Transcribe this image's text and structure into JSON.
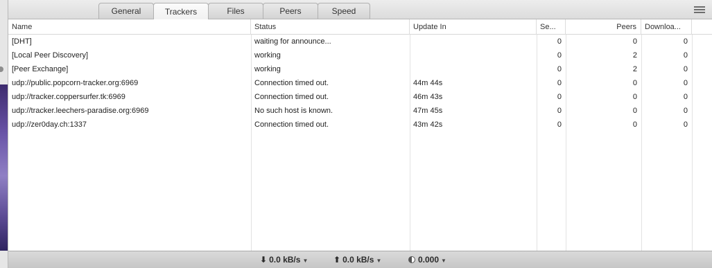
{
  "tabs": [
    {
      "label": "General"
    },
    {
      "label": "Trackers"
    },
    {
      "label": "Files"
    },
    {
      "label": "Peers"
    },
    {
      "label": "Speed"
    }
  ],
  "active_tab": "Trackers",
  "columns": {
    "name": "Name",
    "status": "Status",
    "update_in": "Update In",
    "seeds": "Se...",
    "peers": "Peers",
    "downloads": "Downloa..."
  },
  "rows": [
    {
      "name": "[DHT]",
      "status": "waiting for announce...",
      "update_in": "",
      "seeds": "0",
      "peers": "0",
      "downloads": "0"
    },
    {
      "name": "[Local Peer Discovery]",
      "status": "working",
      "update_in": "",
      "seeds": "0",
      "peers": "2",
      "downloads": "0"
    },
    {
      "name": "[Peer Exchange]",
      "status": "working",
      "update_in": "",
      "seeds": "0",
      "peers": "2",
      "downloads": "0"
    },
    {
      "name": "udp://public.popcorn-tracker.org:6969",
      "status": "Connection timed out.",
      "update_in": "44m 44s",
      "seeds": "0",
      "peers": "0",
      "downloads": "0"
    },
    {
      "name": "udp://tracker.coppersurfer.tk:6969",
      "status": "Connection timed out.",
      "update_in": "46m 43s",
      "seeds": "0",
      "peers": "0",
      "downloads": "0"
    },
    {
      "name": "udp://tracker.leechers-paradise.org:6969",
      "status": "No such host is known.",
      "update_in": "47m 45s",
      "seeds": "0",
      "peers": "0",
      "downloads": "0"
    },
    {
      "name": "udp://zer0day.ch:1337",
      "status": "Connection timed out.",
      "update_in": "43m 42s",
      "seeds": "0",
      "peers": "0",
      "downloads": "0"
    }
  ],
  "statusbar": {
    "download_rate": "0.0 kB/s",
    "upload_rate": "0.0 kB/s",
    "ratio": "0.000",
    "download_icon": "arrow-down-icon",
    "upload_icon": "arrow-up-icon",
    "ratio_icon": "ratio-pie-icon"
  },
  "colors": {
    "grid_line": "#e2e2e2",
    "header_border": "#d6d6d6",
    "statusbar_bg": "#cccccc"
  }
}
